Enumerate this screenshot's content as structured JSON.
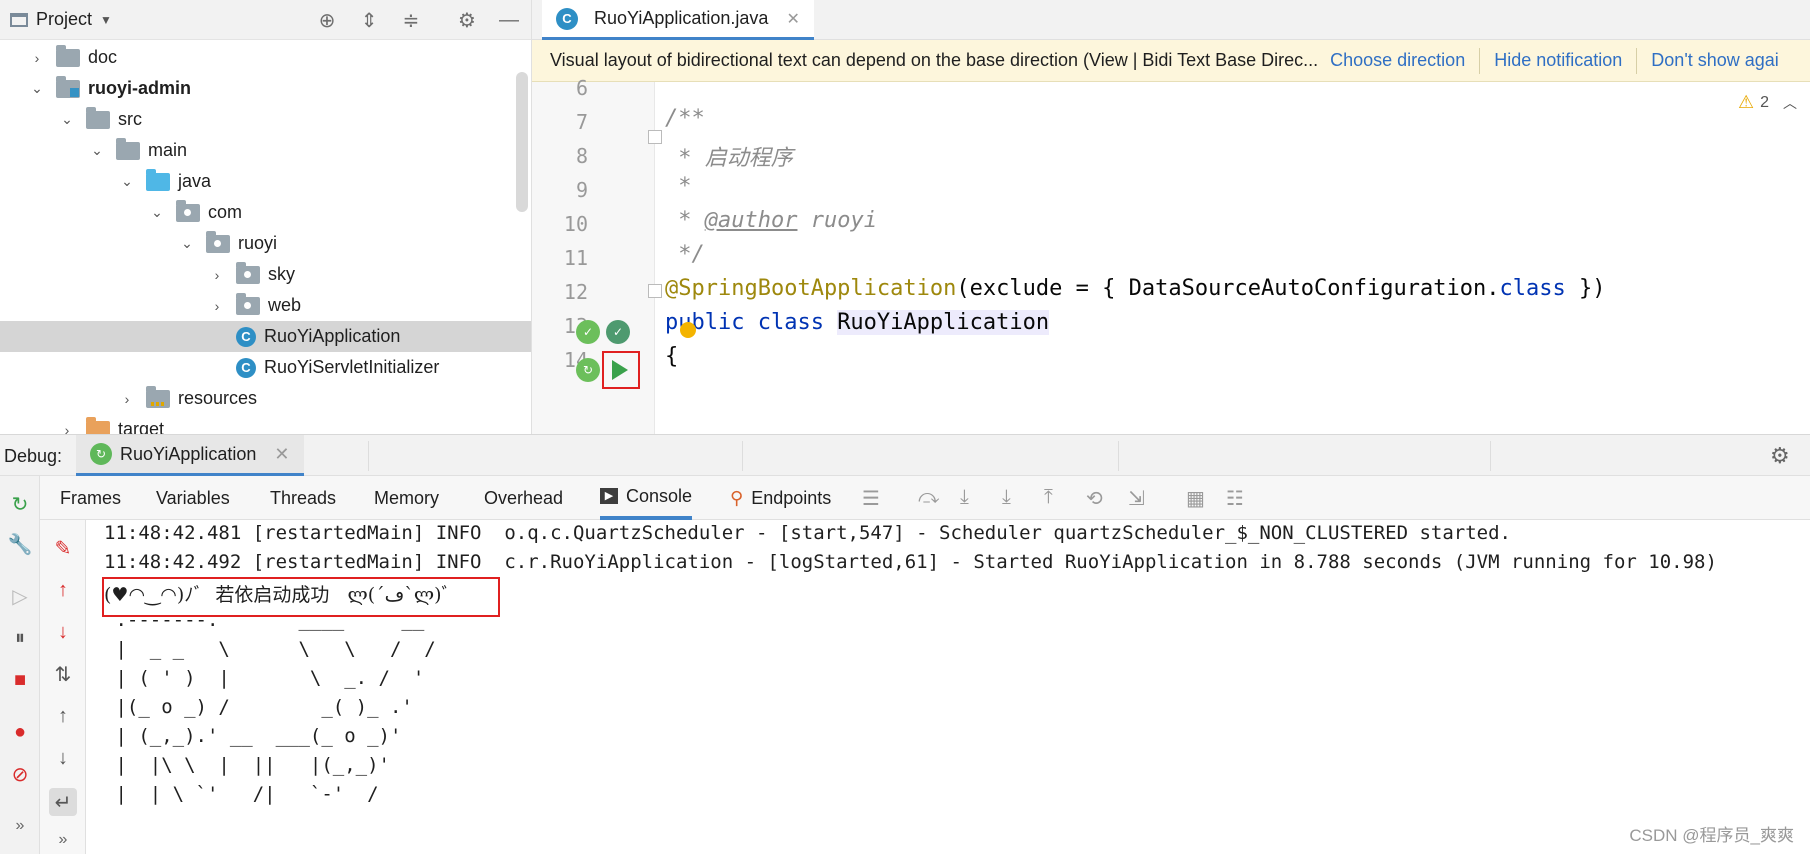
{
  "project": {
    "title": "Project",
    "tree": [
      {
        "label": "doc",
        "chevron": "›",
        "indent": 0,
        "icon": "folder"
      },
      {
        "label": "ruoyi-admin",
        "chevron": "⌄",
        "indent": 0,
        "icon": "module",
        "bold": true
      },
      {
        "label": "src",
        "chevron": "⌄",
        "indent": 1,
        "icon": "folder"
      },
      {
        "label": "main",
        "chevron": "⌄",
        "indent": 2,
        "icon": "folder"
      },
      {
        "label": "java",
        "chevron": "⌄",
        "indent": 3,
        "icon": "source"
      },
      {
        "label": "com",
        "chevron": "⌄",
        "indent": 4,
        "icon": "package"
      },
      {
        "label": "ruoyi",
        "chevron": "⌄",
        "indent": 5,
        "icon": "package"
      },
      {
        "label": "sky",
        "chevron": "›",
        "indent": 6,
        "icon": "package"
      },
      {
        "label": "web",
        "chevron": "›",
        "indent": 6,
        "icon": "package"
      },
      {
        "label": "RuoYiApplication",
        "chevron": "",
        "indent": 6,
        "icon": "class-run",
        "selected": true
      },
      {
        "label": "RuoYiServletInitializer",
        "chevron": "",
        "indent": 6,
        "icon": "class"
      },
      {
        "label": "resources",
        "chevron": "›",
        "indent": 3,
        "icon": "resources"
      },
      {
        "label": "target",
        "chevron": "›",
        "indent": 1,
        "icon": "excluded"
      }
    ]
  },
  "editor": {
    "tab": "RuoYiApplication.java",
    "notification": {
      "message": "Visual layout of bidirectional text can depend on the base direction (View | Bidi Text Base Direc...",
      "choose": "Choose direction",
      "hide": "Hide notification",
      "dont_show": "Don't show agai"
    },
    "warnings": "2",
    "line_numbers": [
      "6",
      "7",
      "8",
      "9",
      "10",
      "11",
      "12",
      "13",
      "14"
    ],
    "lines": {
      "l7": "/**",
      "l8": " * 启动程序",
      "l9": " *",
      "l10_a": " * ",
      "l10_tag": "@author",
      "l10_b": " ruoyi",
      "l11": " */",
      "l12_ann": "@SpringBootApplication",
      "l12_a": "(exclude = { DataSourceAutoConfiguration.",
      "l12_kw": "class",
      "l12_b": " })",
      "l13_kw": "public class ",
      "l13_name": "RuoYiApplication",
      "l14": "{"
    }
  },
  "debug": {
    "label": "Debug:",
    "session_tab": "RuoYiApplication",
    "tabs": [
      "Frames",
      "Variables",
      "Threads",
      "Memory",
      "Overhead",
      "Console",
      "Endpoints"
    ],
    "console_lines": [
      "11:48:42.481 [restartedMain] INFO  o.q.c.QuartzScheduler - [start,547] - Scheduler quartzScheduler_$_NON_CLUSTERED started.",
      "11:48:42.492 [restartedMain] INFO  c.r.RuoYiApplication - [logStarted,61] - Started RuoYiApplication in 8.788 seconds (JVM running for 10.98)",
      "(♥◠‿◠)ﾉﾞ  若依启动成功   ლ(´ڡ`ლ)ﾞ",
      " .-------.       ____     __",
      " |  _ _   \\      \\   \\   /  /",
      " | ( ' )  |       \\  _. /  '",
      " |(_ o _) /        _( )_ .'",
      " | (_,_).' __  ___(_ o _)'",
      " |  |\\ \\  |  ||   |(_,_)'",
      " |  | \\ `'   /|   `-'  /"
    ]
  },
  "watermark": "CSDN @程序员_爽爽"
}
